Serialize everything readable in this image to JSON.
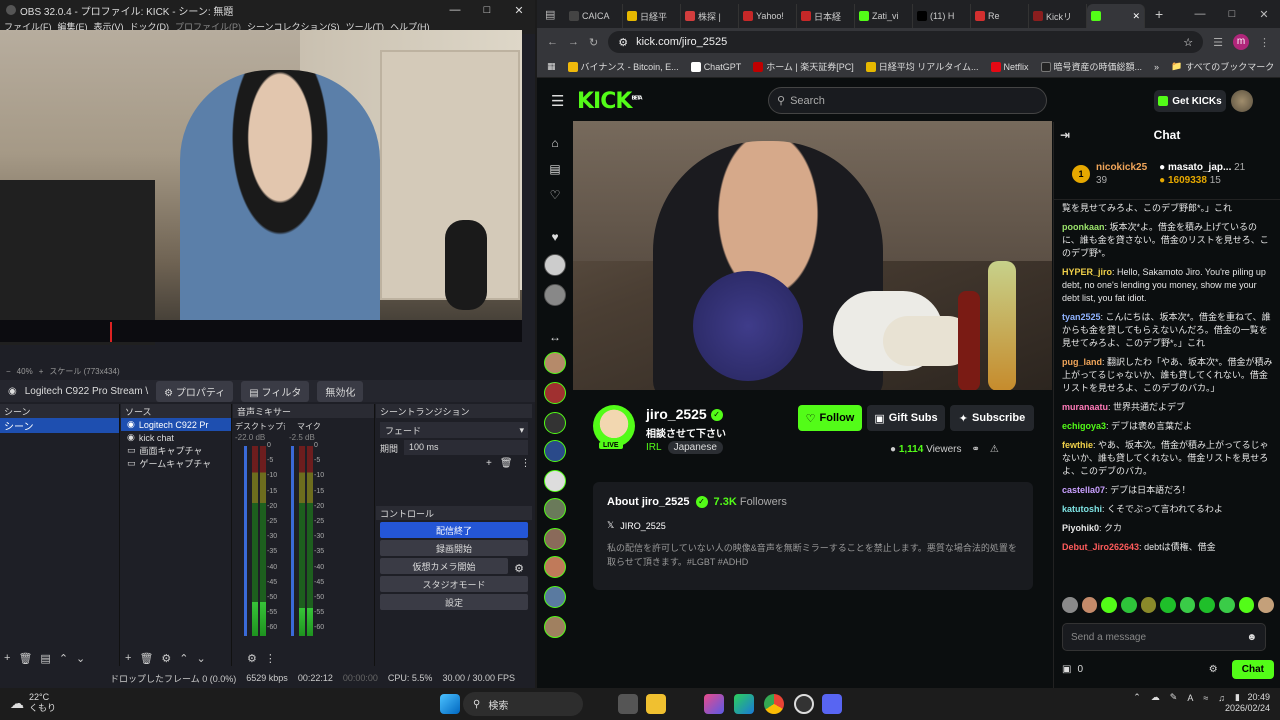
{
  "obs": {
    "title": "OBS 32.0.4 - プロファイル: KICK - シーン: 無題",
    "menu": [
      "ファイル(F)",
      "編集(E)",
      "表示(V)",
      "ドック(D)",
      "プロファイル(P)",
      "シーンコレクション(S)",
      "ツール(T)",
      "ヘルプ(H)"
    ],
    "zoom": "40%",
    "scale_label": "スケール (773x434)",
    "source_name": "Logitech C922 Pro Stream \\",
    "props_button": "プロパティ",
    "filters_button": "フィルタ",
    "disable_button": "無効化",
    "scenes_header": "シーン",
    "scenes": [
      "シーン"
    ],
    "sources_header": "ソース",
    "sources": [
      "Logitech C922 Pr",
      "kick chat",
      "画面キャプチャ",
      "ゲームキャプチャ"
    ],
    "mixer_header": "音声ミキサー",
    "mixer_channels": [
      {
        "name": "デスクトップ音声",
        "db": "-22.0 dB",
        "level": 0.18
      },
      {
        "name": "マイク",
        "db": "-2.5 dB",
        "level": 0.15
      }
    ],
    "meter_ticks": [
      "0",
      "-5",
      "-10",
      "-15",
      "-20",
      "-25",
      "-30",
      "-35",
      "-40",
      "-45",
      "-50",
      "-55",
      "-60"
    ],
    "transitions_header": "シーントランジション",
    "transition_value": "フェード",
    "duration_label": "期間",
    "duration_value": "100 ms",
    "controls_header": "コントロール",
    "controls": [
      "配信終了",
      "録画開始",
      "仮想カメラ開始",
      "スタジオモード",
      "設定"
    ],
    "status": {
      "dropped": "ドロップしたフレーム 0 (0.0%)",
      "bitrate": "6529 kbps",
      "stream_time": "00:22:12",
      "rec_time": "00:00:00",
      "cpu": "CPU: 5.5%",
      "fps": "30.00 / 30.00 FPS"
    }
  },
  "chrome": {
    "tabs": [
      {
        "label": "CAICA",
        "color": "#444444"
      },
      {
        "label": "日経平",
        "color": "#e6b800"
      },
      {
        "label": "株探 |",
        "color": "#d23d3d"
      },
      {
        "label": "Yahoo!",
        "color": "#c62828"
      },
      {
        "label": "日本経",
        "color": "#c62828"
      },
      {
        "label": "Zati_vi",
        "color": "#53fc18"
      },
      {
        "label": "(11) H",
        "color": "#000000"
      },
      {
        "label": "Re",
        "color": "#d32f2f"
      },
      {
        "label": "Kickリ",
        "color": "#8b1e1e"
      },
      {
        "label": "",
        "color": "#53fc18"
      }
    ],
    "url": "kick.com/jiro_2525",
    "bookmarks": [
      "バイナンス - Bitcoin, E...",
      "ChatGPT",
      "ホーム | 楽天証券[PC]",
      "日経平均 リアルタイム...",
      "Netflix",
      "暗号資産の時価総額...",
      "すべてのブックマーク"
    ],
    "profile_initial": "m"
  },
  "kick": {
    "logo": "KICK",
    "logo_badge": "BETA",
    "search_placeholder": "Search",
    "get_kicks": "Get KICKs",
    "channel": {
      "name": "jiro_2525",
      "title": "相談させて下さい",
      "category": "IRL",
      "tag": "Japanese",
      "live": "LIVE",
      "follow": "Follow",
      "gift_subs": "Gift Subs",
      "subscribe": "Subscribe",
      "viewers_count": "1,114",
      "viewers_label": "Viewers",
      "about_title": "About jiro_2525",
      "followers_count": "7.3K",
      "followers_label": "Followers",
      "x_handle": "JIRO_2525",
      "description": "私の配信を許可していない人の映像&音声を無断ミラーすることを禁止します。悪質な場合法的処置を取らせて頂きます。#LGBT #ADHD"
    },
    "chat": {
      "title": "Chat",
      "leaderboard": [
        {
          "rank": "1",
          "user": "nicokick25",
          "value": "39"
        },
        {
          "rank": "",
          "user": "masato_jap...",
          "value": "21"
        },
        {
          "rank": "",
          "user": "1609338",
          "value": "15"
        }
      ],
      "messages": [
        {
          "user": "",
          "color": "#e6e6e6",
          "text": "覧を見せてみろよ、このデブ野郎*。」これ"
        },
        {
          "user": "poonkaan",
          "color": "#9be36b",
          "text": "坂本次*よ。借金を積み上げているのに、誰も金を貸さない。借金のリストを見せろ、このデブ野*。"
        },
        {
          "user": "HYPER_jiro",
          "color": "#f0d04a",
          "text": "Hello, Sakamoto Jiro. You're piling up debt, no one's lending you money, show me your debt list, you fat idiot."
        },
        {
          "user": "tyan2525",
          "color": "#8fb3ff",
          "text": "こんにちは、坂本次*。借金を重ねて、誰からも金を貸してもらえないんだろ。借金の一覧を見せてみろよ、このデブ野*。」これ"
        },
        {
          "user": "pug_land",
          "color": "#f2a65a",
          "text": "翻訳したわ「やあ、坂本次*。借金が積み上がってるじゃないか、誰も貸してくれない。借金リストを見せろよ、このデブのバカ。」"
        },
        {
          "user": "muranaatu",
          "color": "#ff7ab8",
          "text": "世界共通だよデブ"
        },
        {
          "user": "echigoya3",
          "color": "#53fc18",
          "text": "デブは褒め言葉だよ"
        },
        {
          "user": "fewthie",
          "color": "#f0d04a",
          "text": "やあ、坂本次。借金が積み上がってるじゃないか、誰も貸してくれない。借金リストを見せろよ、このデブのバカ。"
        },
        {
          "user": "castella07",
          "color": "#c9a0ff",
          "text": "デブは日本語だろ！"
        },
        {
          "user": "katutoshi",
          "color": "#7ee3e3",
          "text": "くそでぶって言われてるわよ"
        },
        {
          "user": "Piyohik0",
          "color": "#e6e6e6",
          "text": "クカ"
        },
        {
          "user": "Debut_Jiro262643",
          "color": "#ff5c5c",
          "text": "debtは債権、借金"
        }
      ],
      "input_placeholder": "Send a message",
      "points": "0",
      "send": "Chat"
    }
  },
  "taskbar": {
    "temp": "22°C",
    "weather": "くもり",
    "search": "検索",
    "time": "20:49",
    "date": "2026/02/24"
  }
}
